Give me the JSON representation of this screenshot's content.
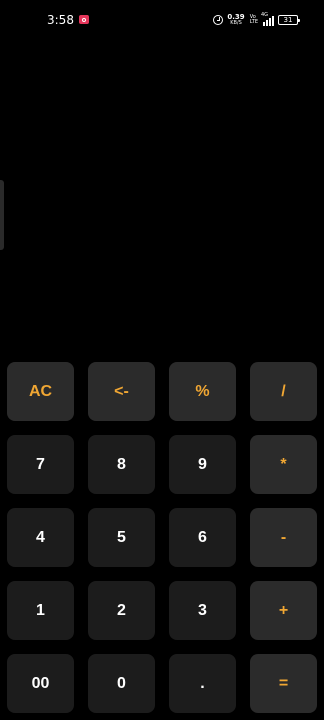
{
  "status_bar": {
    "time": "3:58",
    "net_speed_value": "0.39",
    "net_speed_unit": "KB/S",
    "volte_top": "Vo",
    "volte_bottom": "LTE",
    "network": "4G",
    "battery": "31"
  },
  "display": {
    "expression": ""
  },
  "keypad": {
    "rows": [
      [
        {
          "label": "AC",
          "kind": "func"
        },
        {
          "label": "<-",
          "kind": "func"
        },
        {
          "label": "%",
          "kind": "func"
        },
        {
          "label": "/",
          "kind": "op"
        }
      ],
      [
        {
          "label": "7",
          "kind": "num"
        },
        {
          "label": "8",
          "kind": "num"
        },
        {
          "label": "9",
          "kind": "num"
        },
        {
          "label": "*",
          "kind": "op"
        }
      ],
      [
        {
          "label": "4",
          "kind": "num"
        },
        {
          "label": "5",
          "kind": "num"
        },
        {
          "label": "6",
          "kind": "num"
        },
        {
          "label": "-",
          "kind": "op"
        }
      ],
      [
        {
          "label": "1",
          "kind": "num"
        },
        {
          "label": "2",
          "kind": "num"
        },
        {
          "label": "3",
          "kind": "num"
        },
        {
          "label": "+",
          "kind": "op"
        }
      ],
      [
        {
          "label": "00",
          "kind": "num"
        },
        {
          "label": "0",
          "kind": "num"
        },
        {
          "label": ".",
          "kind": "num"
        },
        {
          "label": "=",
          "kind": "op"
        }
      ]
    ]
  },
  "colors": {
    "background": "#000000",
    "key_number_bg": "#1c1c1c",
    "key_operator_bg": "#2b2b2b",
    "accent": "#f1a733",
    "record_indicator": "#e5355a"
  }
}
